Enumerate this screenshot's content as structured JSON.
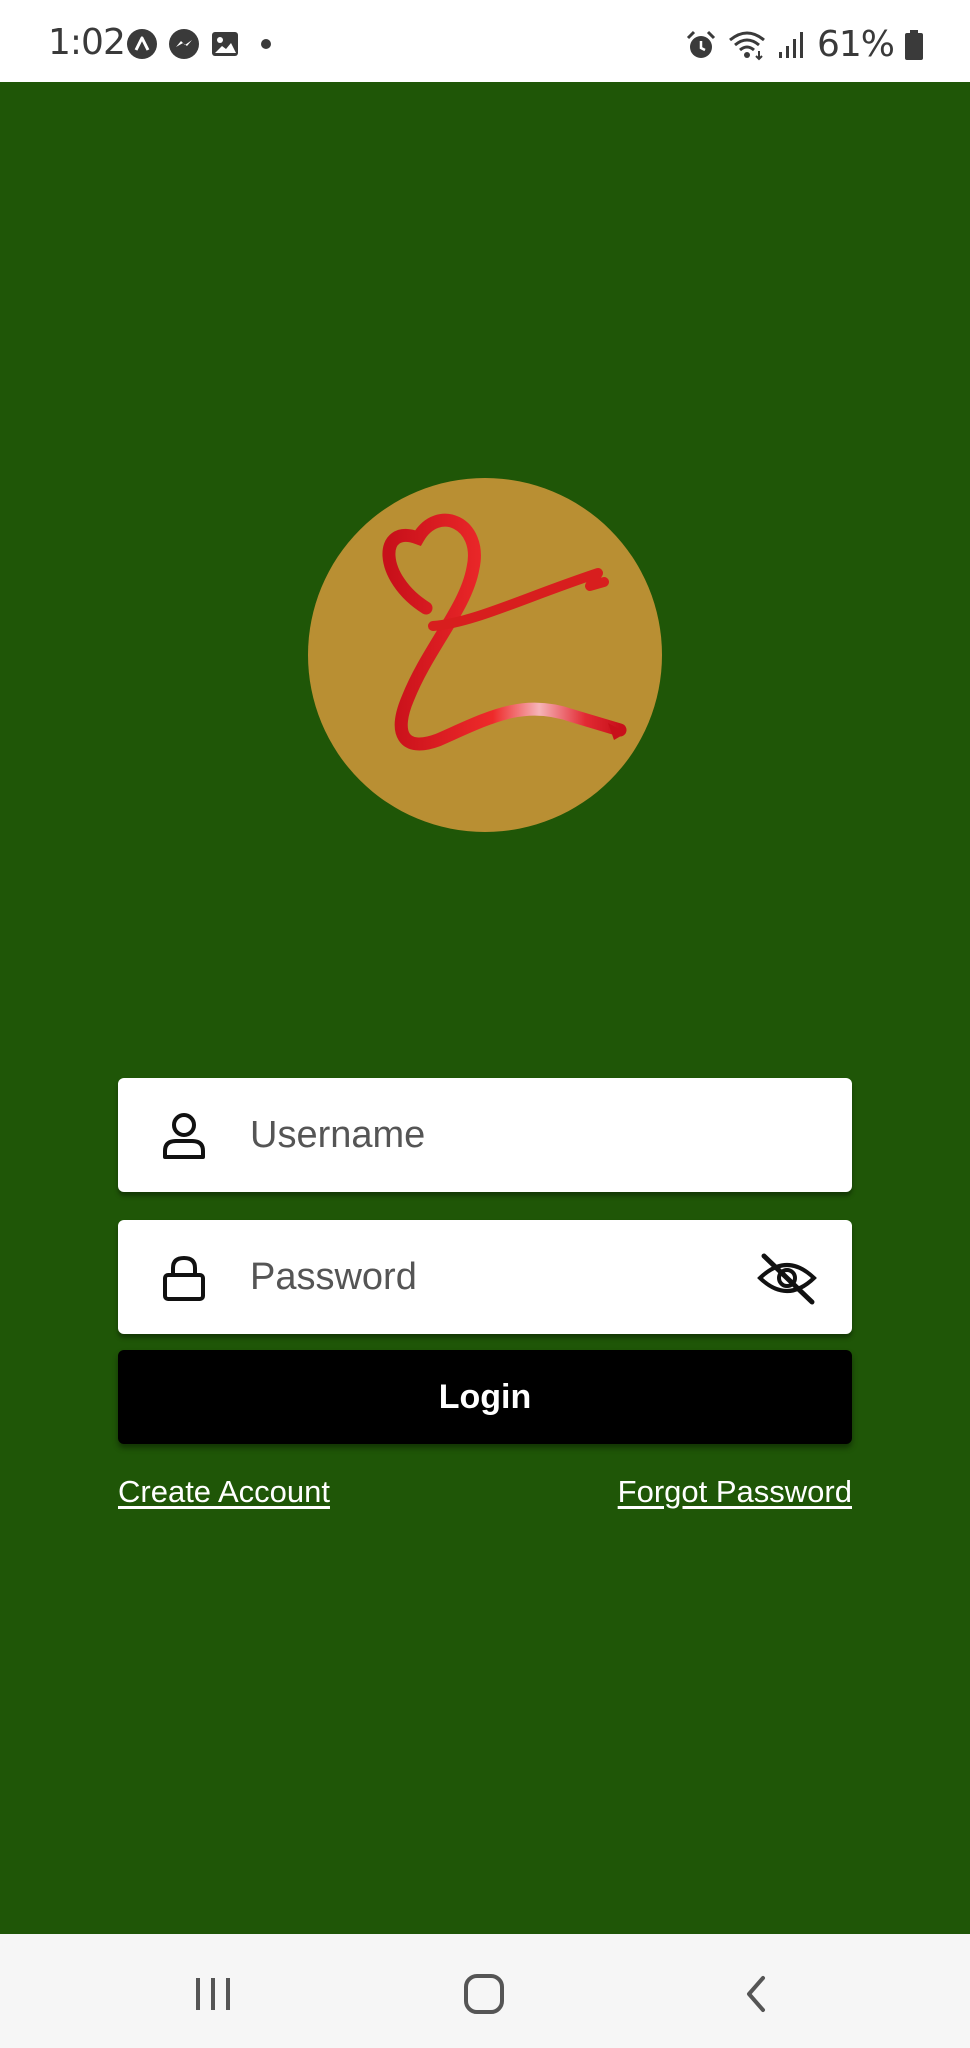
{
  "status_bar": {
    "time": "1:02",
    "battery_percent": "61%",
    "icons_left": [
      "assistant-icon",
      "messenger-icon",
      "gallery-icon",
      "notification-dot-icon"
    ],
    "icons_right": [
      "alarm-icon",
      "wifi-icon",
      "signal-icon",
      "battery-icon"
    ]
  },
  "theme": {
    "background": "#1f5607",
    "logo_circle": "#b98f33",
    "ribbon": "#d81e1e",
    "button": "#000000"
  },
  "login_form": {
    "username_placeholder": "Username",
    "password_placeholder": "Password",
    "login_label": "Login",
    "create_account_label": "Create Account",
    "forgot_password_label": "Forgot Password"
  },
  "nav_bar": {
    "buttons": [
      "recents-icon",
      "home-icon",
      "back-icon"
    ]
  }
}
